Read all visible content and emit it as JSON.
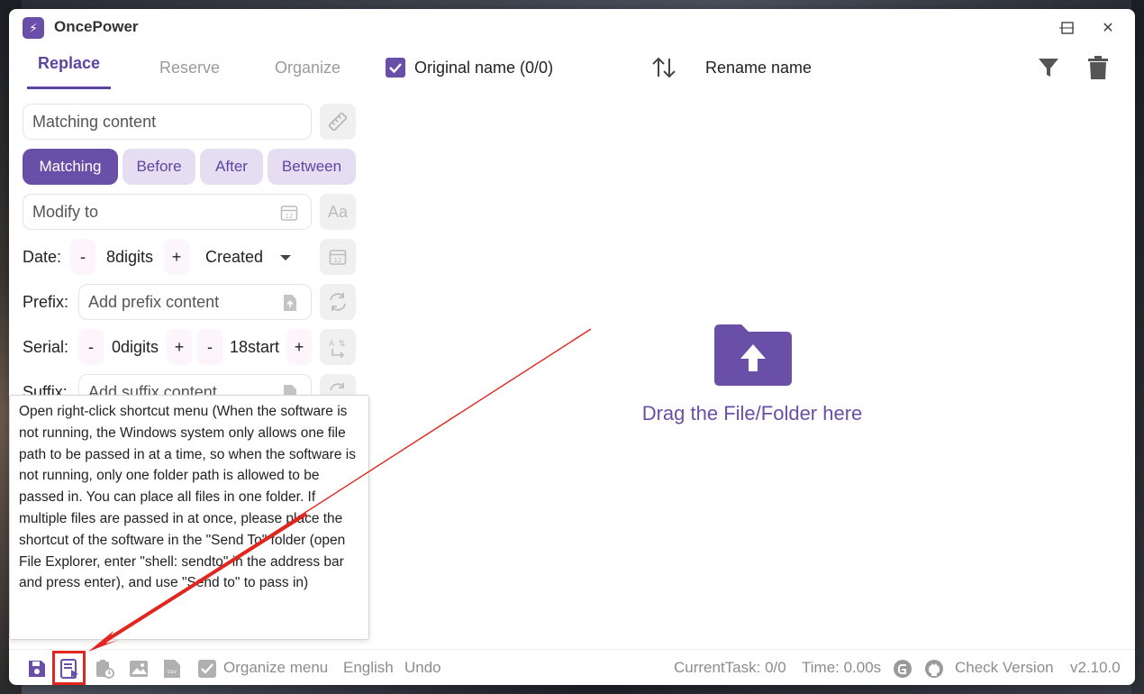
{
  "app": {
    "title": "OncePower",
    "logo_icon": "lightning-icon"
  },
  "window_controls": {
    "minimize": "—",
    "maximize": "☐",
    "close": "✕"
  },
  "tabs": [
    {
      "label": "Replace",
      "active": true
    },
    {
      "label": "Reserve",
      "active": false
    },
    {
      "label": "Organize",
      "active": false
    }
  ],
  "matching": {
    "placeholder": "Matching content"
  },
  "modes": [
    {
      "label": "Matching",
      "active": true
    },
    {
      "label": "Before",
      "active": false
    },
    {
      "label": "After",
      "active": false
    },
    {
      "label": "Between",
      "active": false
    }
  ],
  "modify": {
    "placeholder": "Modify to"
  },
  "date": {
    "label": "Date:",
    "minus": "-",
    "value": "8digits",
    "plus": "+",
    "type": "Created"
  },
  "prefix": {
    "label": "Prefix:",
    "placeholder": "Add prefix content"
  },
  "serial": {
    "label": "Serial:",
    "digits": {
      "minus": "-",
      "value": "0digits",
      "plus": "+"
    },
    "start": {
      "minus": "-",
      "value": "18start",
      "plus": "+"
    }
  },
  "suffix": {
    "label": "Suffix:",
    "placeholder": "Add suffix content"
  },
  "tooltip": {
    "text": "Open right-click shortcut menu (When the software is not running, the Windows system only allows one file path to be passed in at a time, so when the software is not running, only one folder path is allowed to be passed in. You can place all files in one folder. If multiple files are passed in at once, please place the shortcut of the software in the \"Send To\" folder (open File Explorer, enter \"shell: sendto\" in the address bar and press enter), and use \"Send to\" to pass in)"
  },
  "list_header": {
    "original_label": "Original name (0/0)",
    "rename_label": "Rename name"
  },
  "drop_zone": {
    "label": "Drag the File/Folder here"
  },
  "bottom": {
    "organize_menu": "Organize menu",
    "language": "English",
    "undo": "Undo",
    "current_task": "CurrentTask: 0/0",
    "time": "Time: 0.00s",
    "check_version": "Check Version",
    "version": "v2.10.0"
  },
  "colors": {
    "accent": "#6a4fa8",
    "accent_light": "#e5def3",
    "annotation": "#e0261e"
  }
}
